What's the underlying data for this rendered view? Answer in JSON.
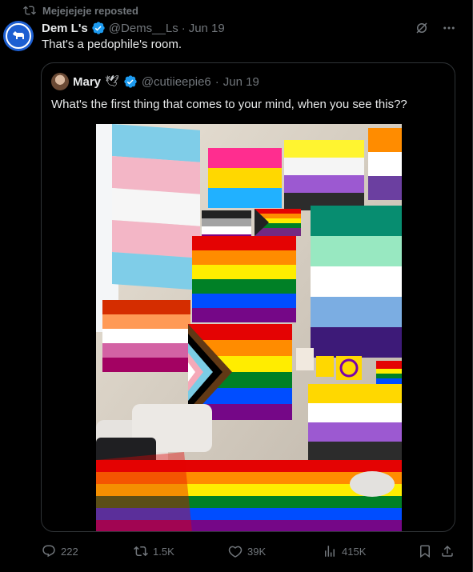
{
  "repost": {
    "label": "Mejejejeje reposted"
  },
  "post": {
    "display_name": "Dem L's",
    "handle": "@Dems__Ls",
    "separator": "·",
    "date": "Jun 19",
    "text": "That's a pedophile's room."
  },
  "quote": {
    "display_name": "Mary",
    "emoji": "🕊",
    "handle": "@cutiieepie6",
    "separator": "·",
    "date": "Jun 19",
    "text": "What's the first thing that comes to your mind, when you see this??"
  },
  "actions": {
    "replies": "222",
    "reposts": "1.5K",
    "likes": "39K",
    "views": "415K"
  },
  "colors": {
    "verified": "#1d9bf0",
    "muted": "#71767b",
    "text": "#e7e9ea"
  }
}
